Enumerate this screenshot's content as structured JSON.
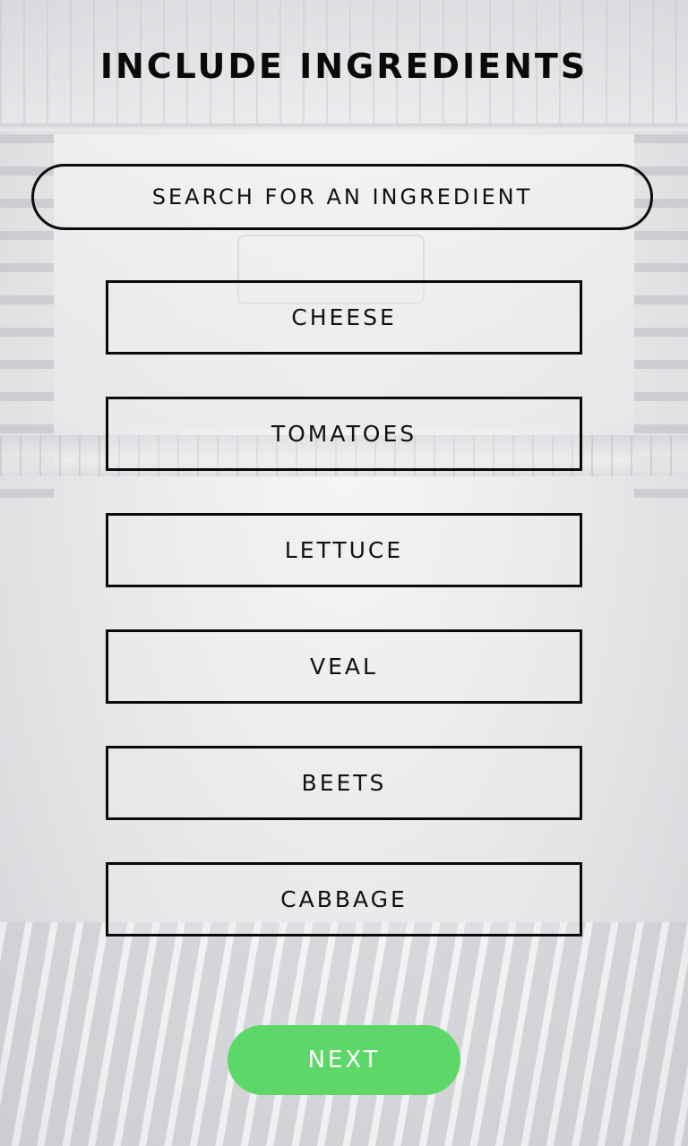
{
  "page": {
    "title": "INCLUDE INGREDIENTS"
  },
  "search": {
    "placeholder": "SEARCH FOR AN INGREDIENT",
    "value": ""
  },
  "ingredients": [
    {
      "label": "CHEESE"
    },
    {
      "label": "TOMATOES"
    },
    {
      "label": "LETTUCE"
    },
    {
      "label": "VEAL"
    },
    {
      "label": "BEETS"
    },
    {
      "label": "CABBAGE"
    }
  ],
  "actions": {
    "next_label": "NEXT"
  },
  "colors": {
    "next_button": "#5dd868",
    "border": "#0b0b0b",
    "text": "#111111"
  },
  "background": {
    "image": "fridge-interior"
  }
}
